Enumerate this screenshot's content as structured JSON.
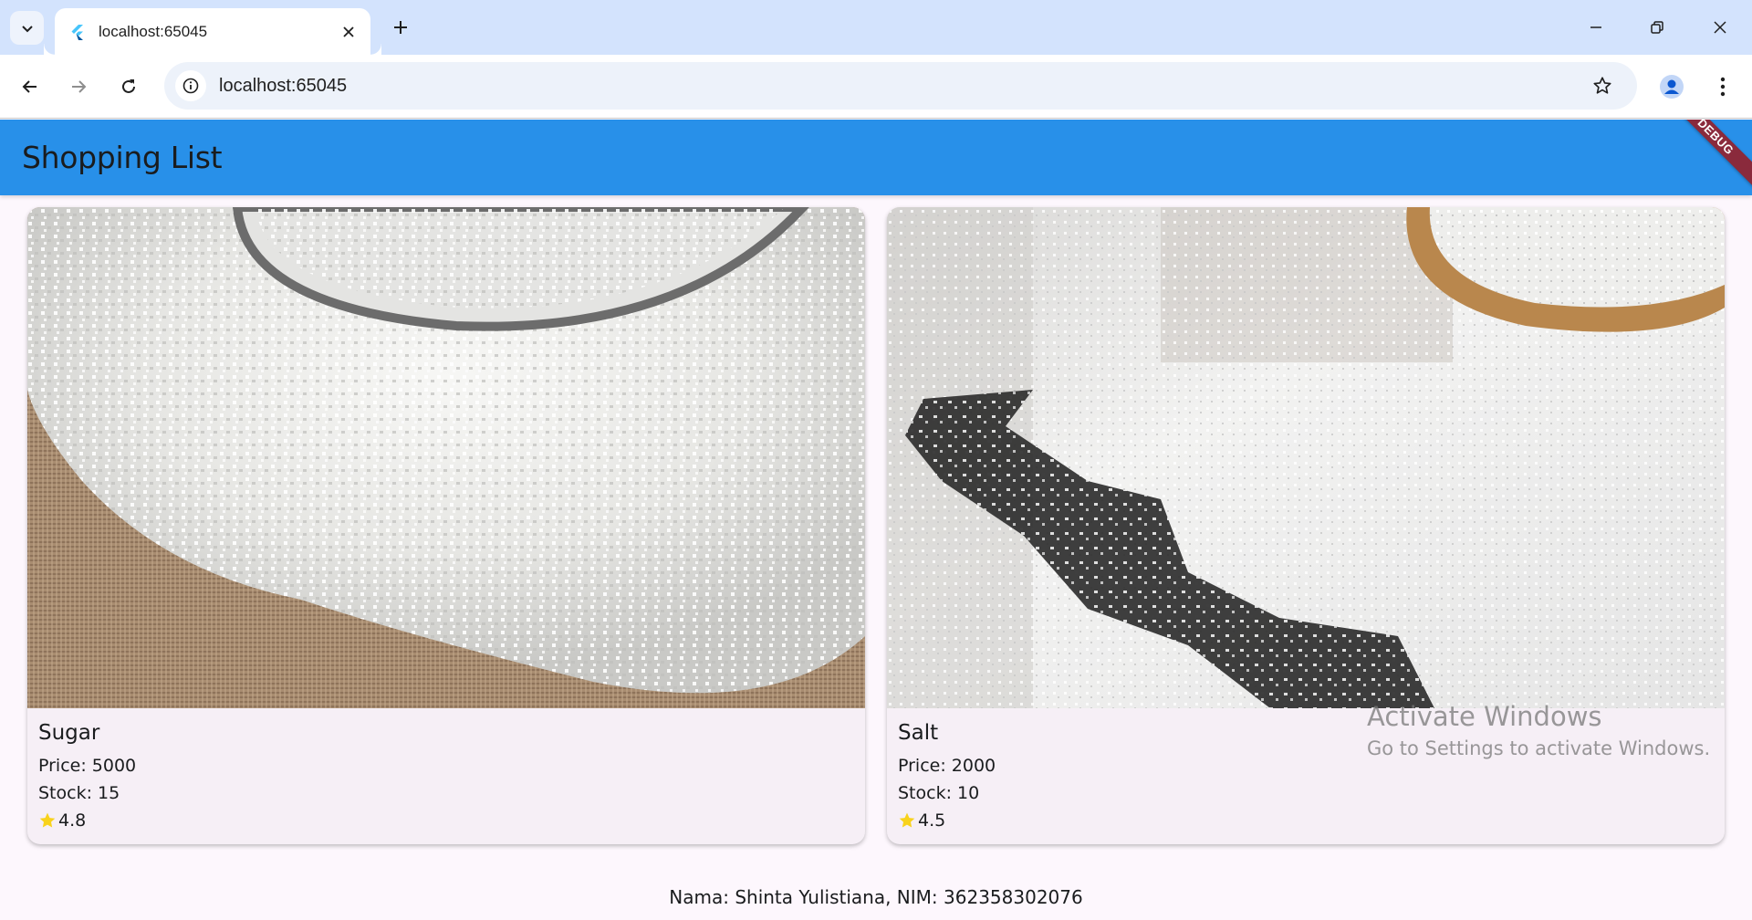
{
  "browser": {
    "tab_title": "localhost:65045",
    "url": "localhost:65045"
  },
  "app": {
    "title": "Shopping List",
    "debug_label": "DEBUG",
    "products": [
      {
        "name": "Sugar",
        "price": "Price: 5000",
        "stock": "Stock: 15",
        "rating": "4.8"
      },
      {
        "name": "Salt",
        "price": "Price: 2000",
        "stock": "Stock: 10",
        "rating": "4.5"
      }
    ],
    "footer": "Nama: Shinta Yulistiana, NIM: 362358302076"
  },
  "windows_watermark": {
    "title": "Activate Windows",
    "subtitle": "Go to Settings to activate Windows."
  },
  "colors": {
    "appbar": "#2890e9",
    "tabstrip": "#d3e3fd",
    "star": "#f8d21c"
  },
  "icons": [
    "tab-search-icon",
    "flutter-favicon-icon",
    "close-icon",
    "plus-icon",
    "minimize-icon",
    "restore-icon",
    "window-close-icon",
    "back-arrow-icon",
    "forward-arrow-icon",
    "reload-icon",
    "site-info-icon",
    "bookmark-star-icon",
    "profile-icon",
    "more-vert-icon",
    "rating-star-icon"
  ]
}
